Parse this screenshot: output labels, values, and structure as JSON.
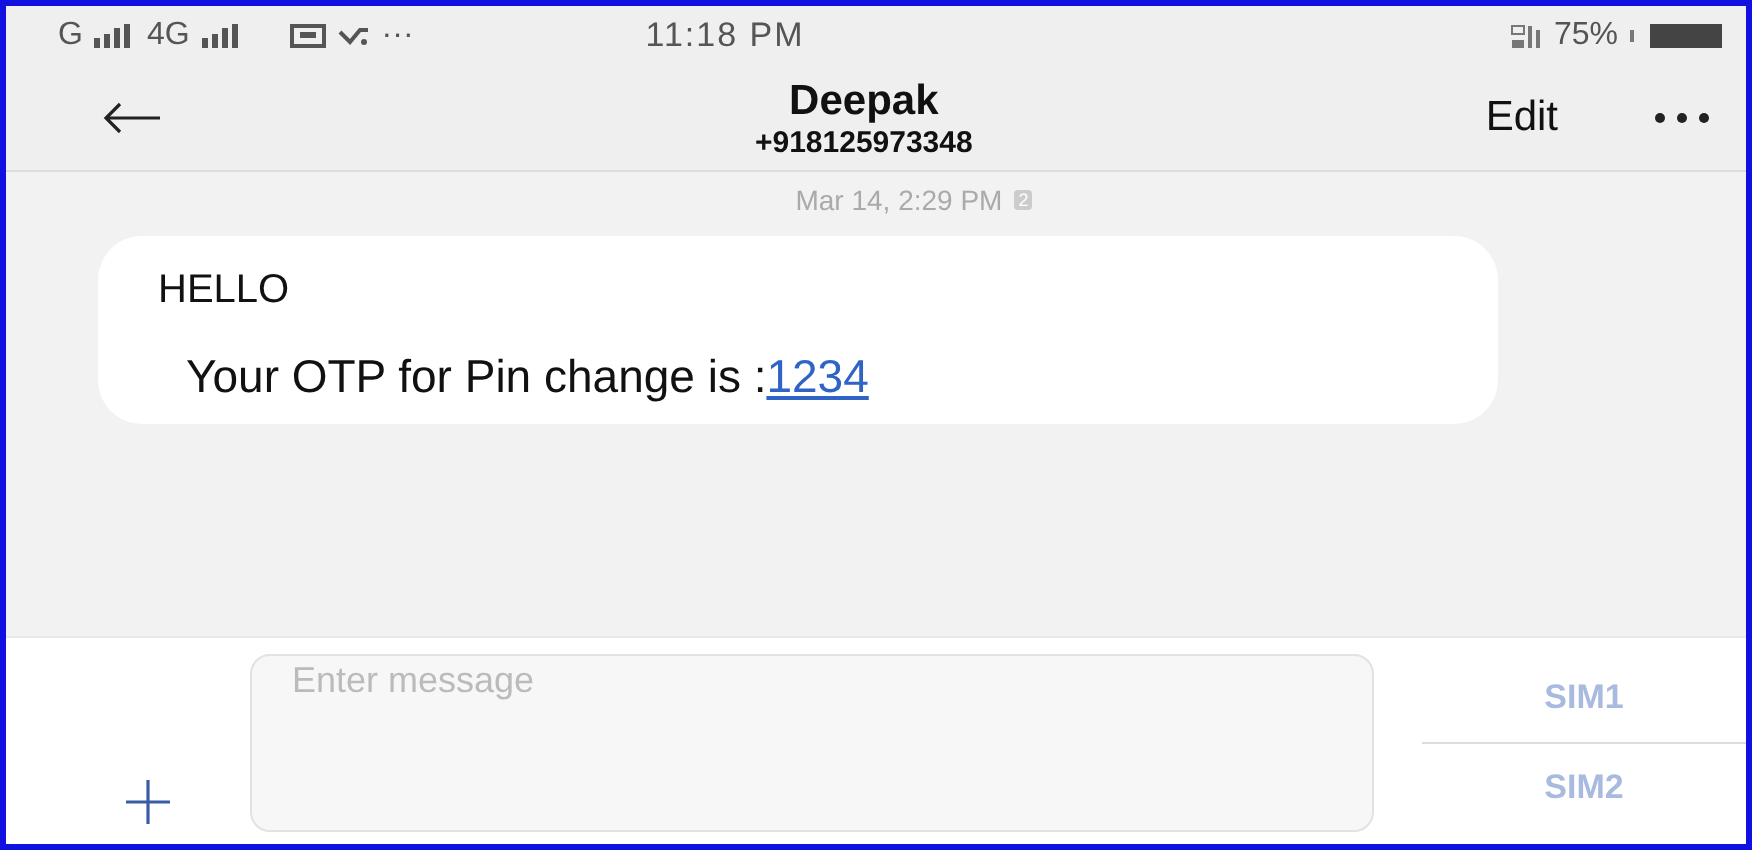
{
  "status_bar": {
    "carrier_1": "G",
    "carrier_2": "4G",
    "more": "···",
    "time": "11:18 PM",
    "battery": "75%"
  },
  "header": {
    "title": "Deepak",
    "subtitle": "+918125973348",
    "edit": "Edit"
  },
  "conversation": {
    "timestamp": "Mar 14, 2:29 PM",
    "sim_badge": "2",
    "message": {
      "lines": [
        "HELLO"
      ],
      "text": "Your OTP for Pin change is :",
      "link": "1234"
    }
  },
  "composer": {
    "placeholder": "Enter message",
    "sim_buttons": [
      "SIM1",
      "SIM2"
    ]
  }
}
